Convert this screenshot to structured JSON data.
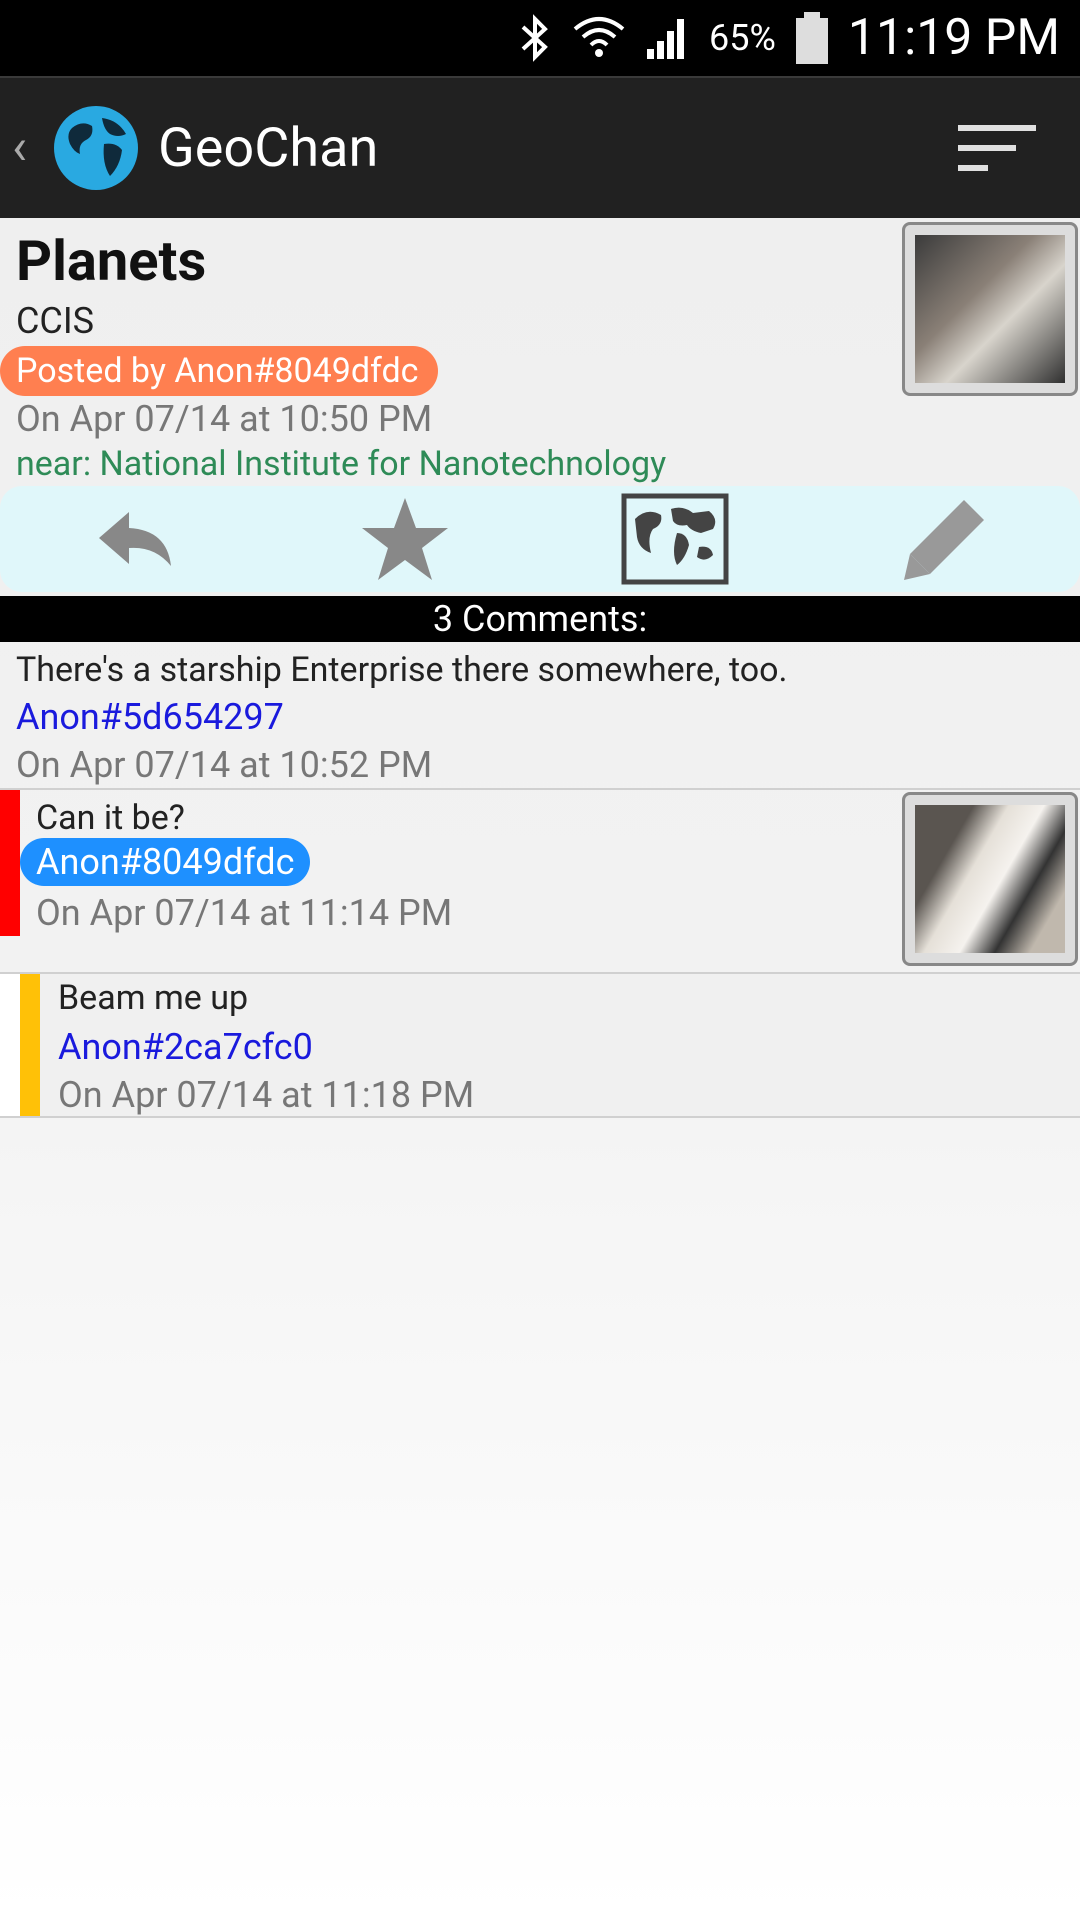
{
  "status_bar": {
    "battery_percent": "65%",
    "time": "11:19 PM"
  },
  "action_bar": {
    "app_title": "GeoChan"
  },
  "post": {
    "title": "Planets",
    "subtitle": "CCIS",
    "byline": "Posted by Anon#8049dfdc",
    "date": "On Apr 07/14 at 10:50 PM",
    "near": "near: National Institute for Nanotechnology",
    "byline_color": "#ff7f50"
  },
  "toolbar": {
    "items": [
      "reply",
      "favorite",
      "map",
      "edit"
    ]
  },
  "comments_header": "3 Comments:",
  "comments": [
    {
      "text": "There's a starship Enterprise there somewhere, too.",
      "author": "Anon#5d654297",
      "date": "On Apr 07/14 at 10:52 PM"
    },
    {
      "text": "Can it be?",
      "author": "Anon#8049dfdc",
      "date": "On Apr 07/14 at 11:14 PM",
      "bar_color": "#ff0000"
    },
    {
      "text": "Beam me up",
      "author": "Anon#2ca7cfc0",
      "date": "On Apr 07/14 at 11:18 PM",
      "bar_color": "#ffc107"
    }
  ]
}
